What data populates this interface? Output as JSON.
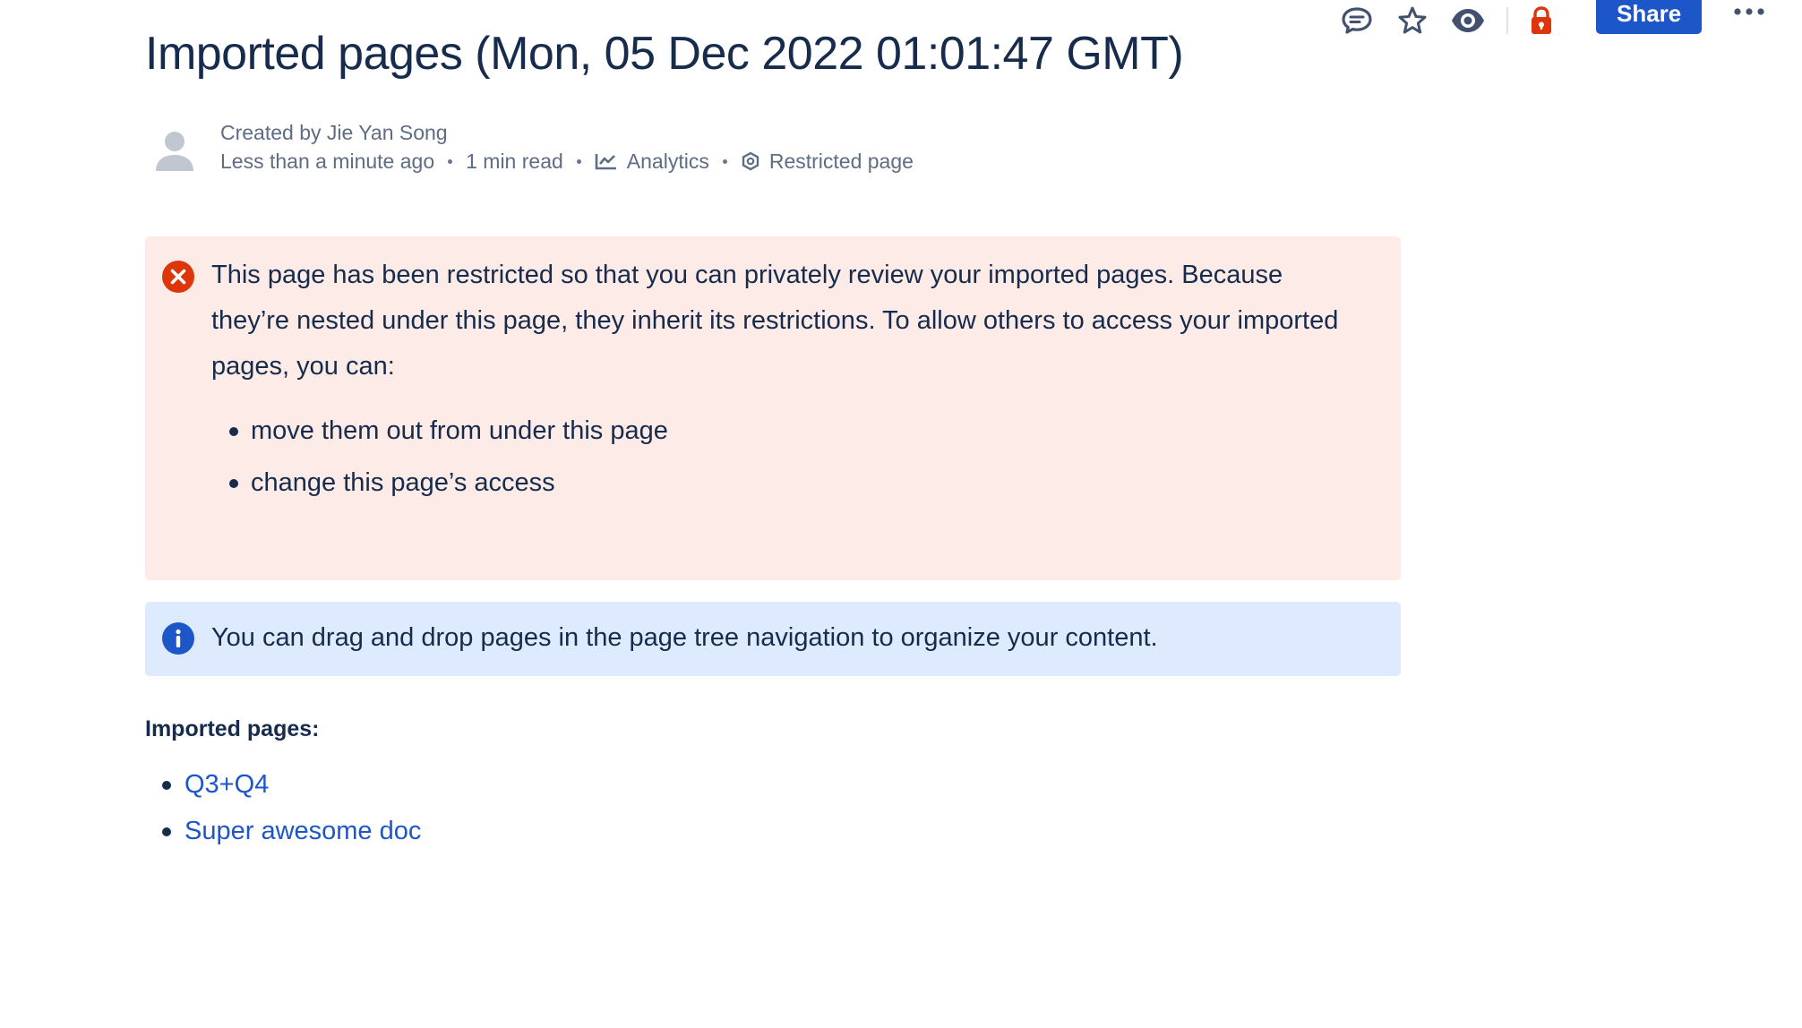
{
  "toolbar": {
    "icons": [
      "comment-icon",
      "star-icon",
      "watch-icon",
      "lock-icon",
      "more-icon"
    ],
    "share_label": "Share",
    "lock_color": "#de350b",
    "share_color": "#1d56c9"
  },
  "page": {
    "title": "Imported pages (Mon, 05 Dec 2022 01:01:47 GMT)"
  },
  "byline": {
    "created_by": "Created by Jie Yan Song",
    "time": "Less than a minute ago",
    "read_time": "1 min read",
    "analytics": "Analytics",
    "restricted": "Restricted page"
  },
  "error_panel": {
    "icon": "error-icon",
    "message": "This page has been restricted so that you can privately review your imported pages. Because they’re nested under this page, they inherit its restrictions. To allow others to access your imported pages, you can:",
    "items": [
      "move them out from under this page",
      "change this page’s access"
    ],
    "color": "#fcebe6"
  },
  "info_panel": {
    "icon": "info-icon",
    "message": "You can drag and drop pages in the page tree navigation to organize your content.",
    "color": "#deebff"
  },
  "imported": {
    "label": "Imported pages:",
    "pages": [
      "Q3+Q4",
      "Super awesome doc"
    ]
  }
}
